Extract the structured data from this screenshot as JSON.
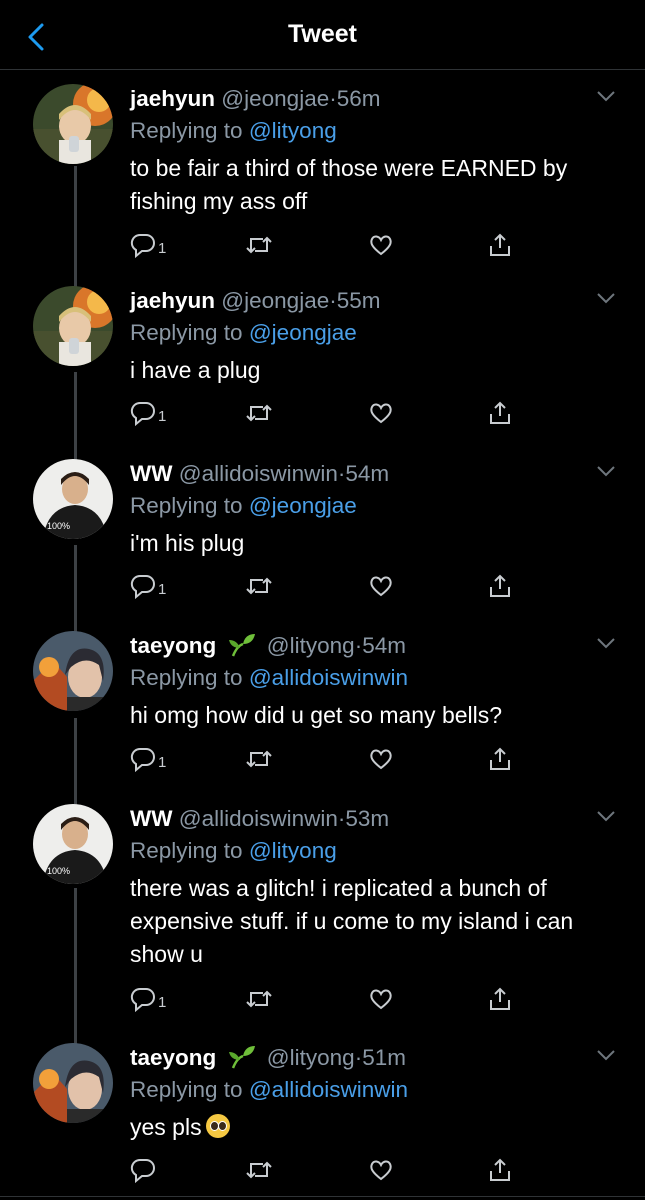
{
  "header": {
    "title": "Tweet"
  },
  "tweets": [
    {
      "name": "jaehyun",
      "handle": "@jeongjae",
      "dot": "·",
      "time": "56m",
      "replying_prefix": "Replying to",
      "replying_to": "@lityong",
      "text": "to be fair a third of those were EARNED by fishing my ass off",
      "reply_count": "1",
      "avatar": "avatar-jaehyun"
    },
    {
      "name": "jaehyun",
      "handle": "@jeongjae",
      "dot": "·",
      "time": "55m",
      "replying_prefix": "Replying to",
      "replying_to": "@jeongjae",
      "text": "i have a plug",
      "reply_count": "1",
      "avatar": "avatar-jaehyun"
    },
    {
      "name": "WW",
      "handle": "@allidoiswinwin",
      "dot": "·",
      "time": "54m",
      "replying_prefix": "Replying to",
      "replying_to": "@jeongjae",
      "text": "i'm his plug",
      "reply_count": "1",
      "avatar": "avatar-ww"
    },
    {
      "name": "taeyong",
      "name_emoji": "seedling-icon",
      "handle": "@lityong",
      "dot": "·",
      "time": "54m",
      "replying_prefix": "Replying to",
      "replying_to": "@allidoiswinwin",
      "text": "hi omg how did u get so many bells?",
      "reply_count": "1",
      "avatar": "avatar-taeyong"
    },
    {
      "name": "WW",
      "handle": "@allidoiswinwin",
      "dot": "·",
      "time": "53m",
      "replying_prefix": "Replying to",
      "replying_to": "@lityong",
      "text": "there was a glitch! i replicated a bunch of expensive stuff. if u come to my island i can show u",
      "reply_count": "1",
      "avatar": "avatar-ww"
    },
    {
      "name": "taeyong",
      "name_emoji": "seedling-icon",
      "handle": "@lityong",
      "dot": "·",
      "time": "51m",
      "replying_prefix": "Replying to",
      "replying_to": "@allidoiswinwin",
      "text": "yes pls",
      "text_emoji": "pleading-face-icon",
      "reply_count": "",
      "avatar": "avatar-taeyong"
    }
  ],
  "colors": {
    "background": "#000000",
    "link": "#4a9fe8",
    "muted": "#8b98a5",
    "accent": "#1d9bf0"
  }
}
